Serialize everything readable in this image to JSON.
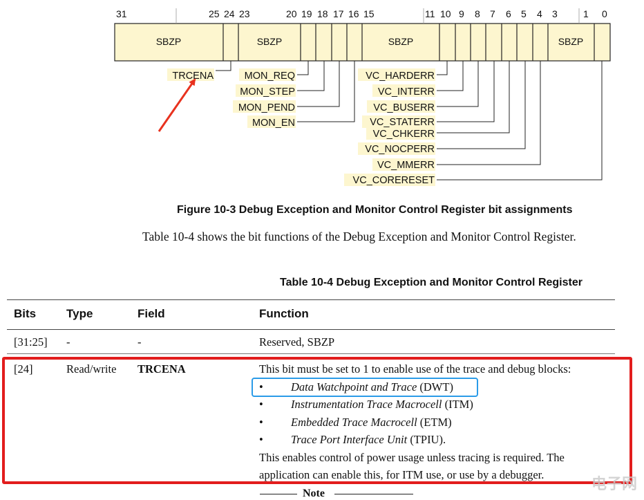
{
  "figure": {
    "bit_numbers": [
      "31",
      "25",
      "24",
      "23",
      "20",
      "19",
      "18",
      "17",
      "16",
      "15",
      "11",
      "10",
      "9",
      "8",
      "7",
      "6",
      "5",
      "4",
      "3",
      "1",
      "0"
    ],
    "fields": [
      "SBZP",
      "SBZP",
      "SBZP",
      "SBZP"
    ],
    "left_labels": [
      "TRCENA",
      "MON_REQ",
      "MON_STEP",
      "MON_PEND",
      "MON_EN"
    ],
    "right_labels": [
      "VC_HARDERR",
      "VC_INTERR",
      "VC_BUSERR",
      "VC_STATERR",
      "VC_CHKERR",
      "VC_NOCPERR",
      "VC_MMERR",
      "VC_CORERESET"
    ],
    "caption": "Figure 10-3 Debug Exception and Monitor Control Register bit assignments",
    "box_fill": "#fdf6cf",
    "label_highlight": "#fdf6cf",
    "arrow_color": "#e8321f"
  },
  "paragraph": "Table 10-4 shows the bit functions of the Debug Exception and Monitor Control Register.",
  "table": {
    "caption": "Table 10-4 Debug Exception and Monitor Control Register",
    "headers": [
      "Bits",
      "Type",
      "Field",
      "Function"
    ],
    "rows": [
      {
        "bits": "[31:25]",
        "type": "-",
        "field": "-",
        "function": "Reserved, SBZP"
      },
      {
        "bits": "[24]",
        "type": "Read/write",
        "field": "TRCENA",
        "function_intro": "This bit must be set to 1 to enable use of the trace and debug blocks:",
        "items": [
          {
            "name": "Data Watchpoint and Trace",
            "abbr": "(DWT)"
          },
          {
            "name": "Instrumentation Trace Macrocell",
            "abbr": "(ITM)"
          },
          {
            "name": "Embedded Trace Macrocell",
            "abbr": "(ETM)"
          },
          {
            "name": "Trace Port Interface Unit",
            "abbr": "(TPIU)."
          }
        ],
        "function_outro": "This enables control of power usage unless tracing is required. The application can enable this, for ITM use, or use by a debugger."
      }
    ]
  },
  "note_label": "Note",
  "watermark": "电子网",
  "bullet_char": "•",
  "highlight_colors": {
    "red": "#e21d1d",
    "blue": "#2a9be8"
  }
}
